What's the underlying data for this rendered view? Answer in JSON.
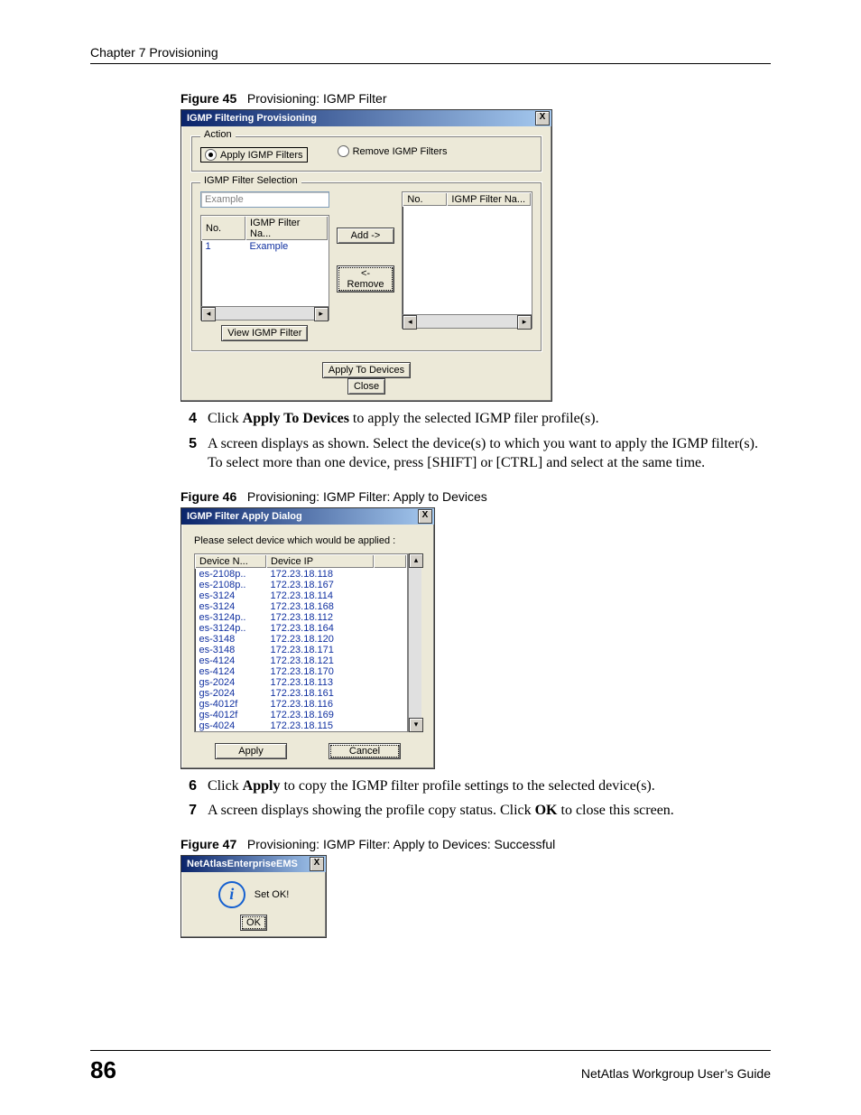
{
  "header": {
    "chapter": "Chapter 7 Provisioning"
  },
  "fig45": {
    "caption_label": "Figure 45",
    "caption_text": "Provisioning: IGMP Filter",
    "dialog": {
      "title": "IGMP Filtering Provisioning",
      "close_x": "X",
      "action_legend": "Action",
      "radio_apply": "Apply IGMP Filters",
      "radio_remove": "Remove IGMP Filters",
      "selection_legend": "IGMP Filter Selection",
      "example_value": "Example",
      "left_list": {
        "col_no": "No.",
        "col_name": "IGMP Filter Na...",
        "rows": [
          {
            "no": "1",
            "name": "Example"
          }
        ]
      },
      "right_list": {
        "col_no": "No.",
        "col_name": "IGMP Filter Na..."
      },
      "btn_add": "Add ->",
      "btn_remove": "<- Remove",
      "btn_view": "View IGMP Filter",
      "btn_apply_dev": "Apply To Devices",
      "btn_close": "Close"
    }
  },
  "steps45": {
    "n4": "4",
    "s4_a": "Click ",
    "s4_b": "Apply To Devices",
    "s4_c": " to apply the selected IGMP filer profile(s).",
    "n5": "5",
    "s5": "A screen displays as shown. Select the device(s) to which you want to apply the IGMP filter(s). To select more than one device, press [SHIFT] or [CTRL] and select at the same time."
  },
  "fig46": {
    "caption_label": "Figure 46",
    "caption_text": "Provisioning: IGMP Filter: Apply to Devices",
    "dialog": {
      "title": "IGMP Filter Apply Dialog",
      "close_x": "X",
      "prompt": "Please select device which would be applied :",
      "col_name": "Device N...",
      "col_ip": "Device IP",
      "rows": [
        {
          "name": "es-2108p..",
          "ip": "172.23.18.118"
        },
        {
          "name": "es-2108p..",
          "ip": "172.23.18.167"
        },
        {
          "name": "es-3124",
          "ip": "172.23.18.114"
        },
        {
          "name": "es-3124",
          "ip": "172.23.18.168"
        },
        {
          "name": "es-3124p..",
          "ip": "172.23.18.112"
        },
        {
          "name": "es-3124p..",
          "ip": "172.23.18.164"
        },
        {
          "name": "es-3148",
          "ip": "172.23.18.120"
        },
        {
          "name": "es-3148",
          "ip": "172.23.18.171"
        },
        {
          "name": "es-4124",
          "ip": "172.23.18.121"
        },
        {
          "name": "es-4124",
          "ip": "172.23.18.170"
        },
        {
          "name": "gs-2024",
          "ip": "172.23.18.113"
        },
        {
          "name": "gs-2024",
          "ip": "172.23.18.161"
        },
        {
          "name": "gs-4012f",
          "ip": "172.23.18.116"
        },
        {
          "name": "gs-4012f",
          "ip": "172.23.18.169"
        },
        {
          "name": "gs-4024",
          "ip": "172.23.18.115"
        }
      ],
      "btn_apply": "Apply",
      "btn_cancel": "Cancel"
    }
  },
  "steps46": {
    "n6": "6",
    "s6_a": "Click ",
    "s6_b": "Apply",
    "s6_c": " to copy the IGMP filter profile settings to the selected device(s).",
    "n7": "7",
    "s7_a": "A screen displays showing the profile copy status. Click ",
    "s7_b": "OK",
    "s7_c": " to close this screen."
  },
  "fig47": {
    "caption_label": "Figure 47",
    "caption_text": "Provisioning: IGMP Filter: Apply to Devices: Successful",
    "dialog": {
      "title": "NetAtlasEnterpriseEMS",
      "close_x": "X",
      "message": "Set OK!",
      "btn_ok": "OK"
    }
  },
  "footer": {
    "page": "86",
    "guide": "NetAtlas Workgroup User’s Guide"
  },
  "glyphs": {
    "left": "◂",
    "right": "▸",
    "up": "▴",
    "down": "▾"
  }
}
